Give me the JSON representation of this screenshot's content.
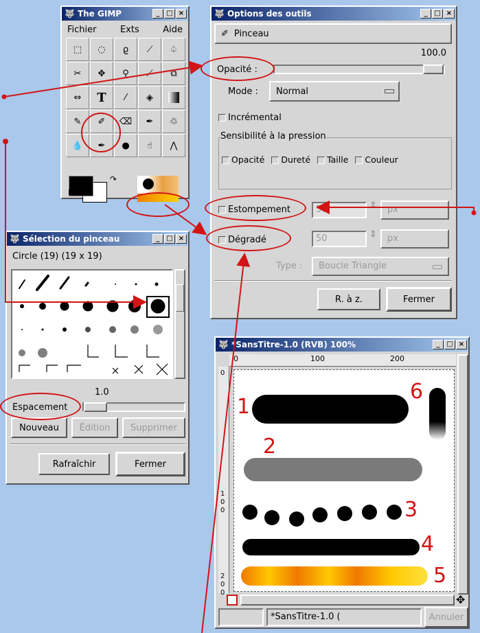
{
  "gimp": {
    "title": "The GIMP",
    "menu": [
      "Fichier",
      "Exts",
      "Aide"
    ],
    "tools": [
      "rect-select",
      "ellipse-select",
      "lasso",
      "fuzzy-select",
      "bezier-select",
      "scissors",
      "move",
      "magnify",
      "crop",
      "transform",
      "flip",
      "text",
      "color-picker",
      "bucket-fill",
      "gradient",
      "pencil",
      "paintbrush",
      "eraser",
      "airbrush",
      "clone",
      "convolve",
      "ink",
      "dodge-burn",
      "smudge",
      "measure"
    ]
  },
  "options": {
    "title": "Options des outils",
    "tool_name": "Pinceau",
    "opacity_value": "100.0",
    "opacity_label": "Opacité :",
    "mode_label": "Mode :",
    "mode_value": "Normal",
    "incremental": "Incrémental",
    "pressure_title": "Sensibilité à la pression",
    "pressure": [
      "Opacité",
      "Dureté",
      "Taille",
      "Couleur"
    ],
    "fade_label": "Estompement",
    "fade_value": "50",
    "fade_unit": "px",
    "gradient_label": "Dégradé",
    "gradient_value": "50",
    "gradient_unit": "px",
    "type_label": "Type :",
    "type_value": "Boucle Triangle",
    "reset": "R. à z.",
    "close": "Fermer"
  },
  "brush": {
    "title": "Sélection du pinceau",
    "current": "Circle (19)  (19 x 19)",
    "spacing_value": "1.0",
    "spacing_label": "Espacement",
    "new": "Nouveau",
    "edit": "Édition",
    "delete": "Supprimer",
    "refresh": "Rafraîchir",
    "close": "Fermer"
  },
  "canvas": {
    "title": "*SansTitre-1.0 (RVB) 100%",
    "ruler_top": [
      "0",
      "100",
      "200"
    ],
    "ruler_left": [
      "0",
      "1",
      "0",
      "0",
      "1",
      "0",
      "0",
      "2",
      "0",
      "0"
    ],
    "status": "*SansTitre-1.0 (",
    "cancel": "Annuler",
    "stroke_numbers": [
      "1",
      "2",
      "3",
      "4",
      "5",
      "6"
    ]
  },
  "colors": {
    "annotation": "#d21414",
    "desktop": "#a9c8ec",
    "titlebar": "#0a246a"
  }
}
